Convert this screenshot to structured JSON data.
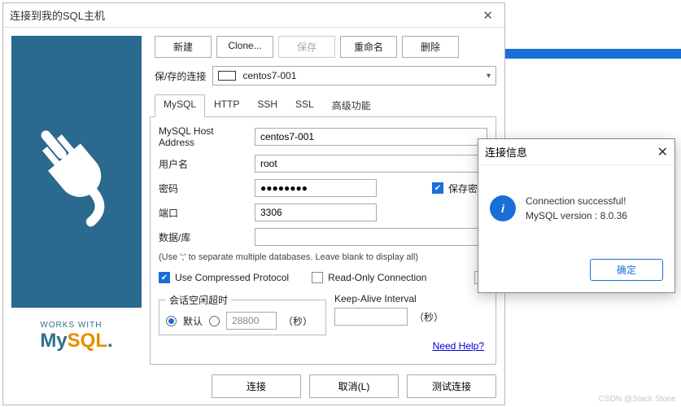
{
  "watermark": "CSDN @Stack Stone",
  "window": {
    "title": "连接到我的SQL主机",
    "close_glyph": "✕"
  },
  "toolbar": {
    "new": "新建",
    "clone": "Clone...",
    "save": "保存",
    "rename": "重命名",
    "delete": "删除"
  },
  "saved": {
    "label": "保/存的连接",
    "value": "centos7-001"
  },
  "tabs": {
    "mysql": "MySQL",
    "http": "HTTP",
    "ssh": "SSH",
    "ssl": "SSL",
    "advanced": "高级功能"
  },
  "fields": {
    "host_label": "MySQL Host Address",
    "host_value": "centos7-001",
    "user_label": "用户名",
    "user_value": "root",
    "pass_label": "密码",
    "pass_value": "●●●●●●●●",
    "save_pass_label": "保存密码",
    "port_label": "端口",
    "port_value": "3306",
    "db_label": "数据/库",
    "db_value": "",
    "db_hint": "(Use ';' to separate multiple databases. Leave blank to display all)",
    "compress_label": "Use Compressed Protocol",
    "readonly_label": "Read-Only Connection",
    "help_glyph": "?"
  },
  "session": {
    "group_label": "会话空闲超时",
    "default_label": "默认",
    "timeout_placeholder": "28800",
    "unit": "（秒）"
  },
  "keepalive": {
    "label": "Keep-Alive Interval",
    "value": "",
    "unit": "（秒）"
  },
  "help_link": "Need Help?",
  "footer": {
    "connect": "连接",
    "cancel": "取消(L)",
    "test": "测试连接"
  },
  "logo": {
    "works_with": "WORKS WITH",
    "my": "My",
    "sql": "SQL",
    "dot": "."
  },
  "popup": {
    "title": "连接信息",
    "close_glyph": "✕",
    "line1": "Connection successful!",
    "line2": "MySQL version : 8.0.36",
    "ok": "确定"
  }
}
